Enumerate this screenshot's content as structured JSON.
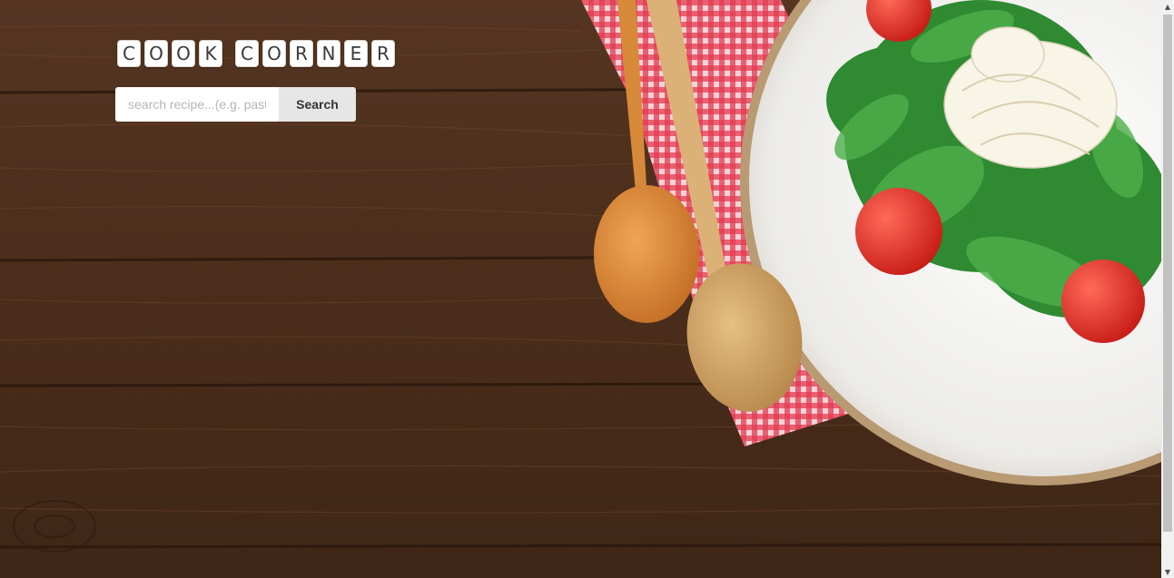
{
  "header": {
    "logo_letters": [
      "C",
      "O",
      "O",
      "K",
      " ",
      "C",
      "O",
      "R",
      "N",
      "E",
      "R"
    ]
  },
  "search": {
    "placeholder": "search recipe...(e.g. pasta",
    "button_label": "Search"
  },
  "scrollbar": {
    "up_icon": "triangle-up",
    "down_icon": "triangle-down",
    "position": 0
  },
  "colors": {
    "wood": "#4a2e1c",
    "napkin_red": "#d9223a",
    "tomato": "#e0332a",
    "plate": "#f2f0ec",
    "button_bg": "#e6e6e6"
  }
}
